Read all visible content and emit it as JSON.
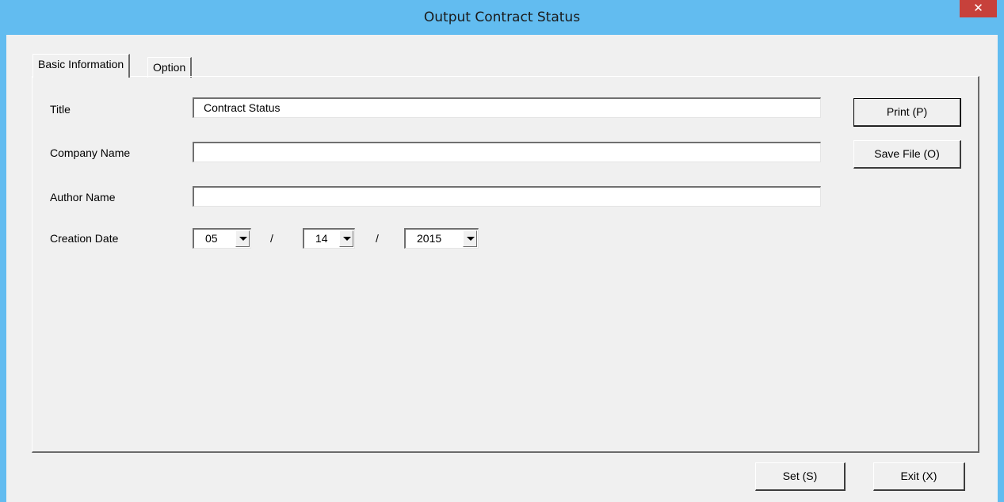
{
  "window": {
    "title": "Output Contract Status",
    "close_glyph": "✕"
  },
  "tabs": [
    {
      "label": "Basic Information",
      "active": true
    },
    {
      "label": "Option",
      "active": false
    }
  ],
  "form": {
    "title_label": "Title",
    "title_value": "Contract Status",
    "company_label": "Company Name",
    "company_value": "",
    "author_label": "Author Name",
    "author_value": "",
    "date_label": "Creation Date",
    "date_month": "05",
    "date_day": "14",
    "date_year": "2015",
    "date_separator": "/"
  },
  "buttons": {
    "print": "Print (P)",
    "save_file": "Save File (O)",
    "set": "Set (S)",
    "exit": "Exit (X)"
  }
}
